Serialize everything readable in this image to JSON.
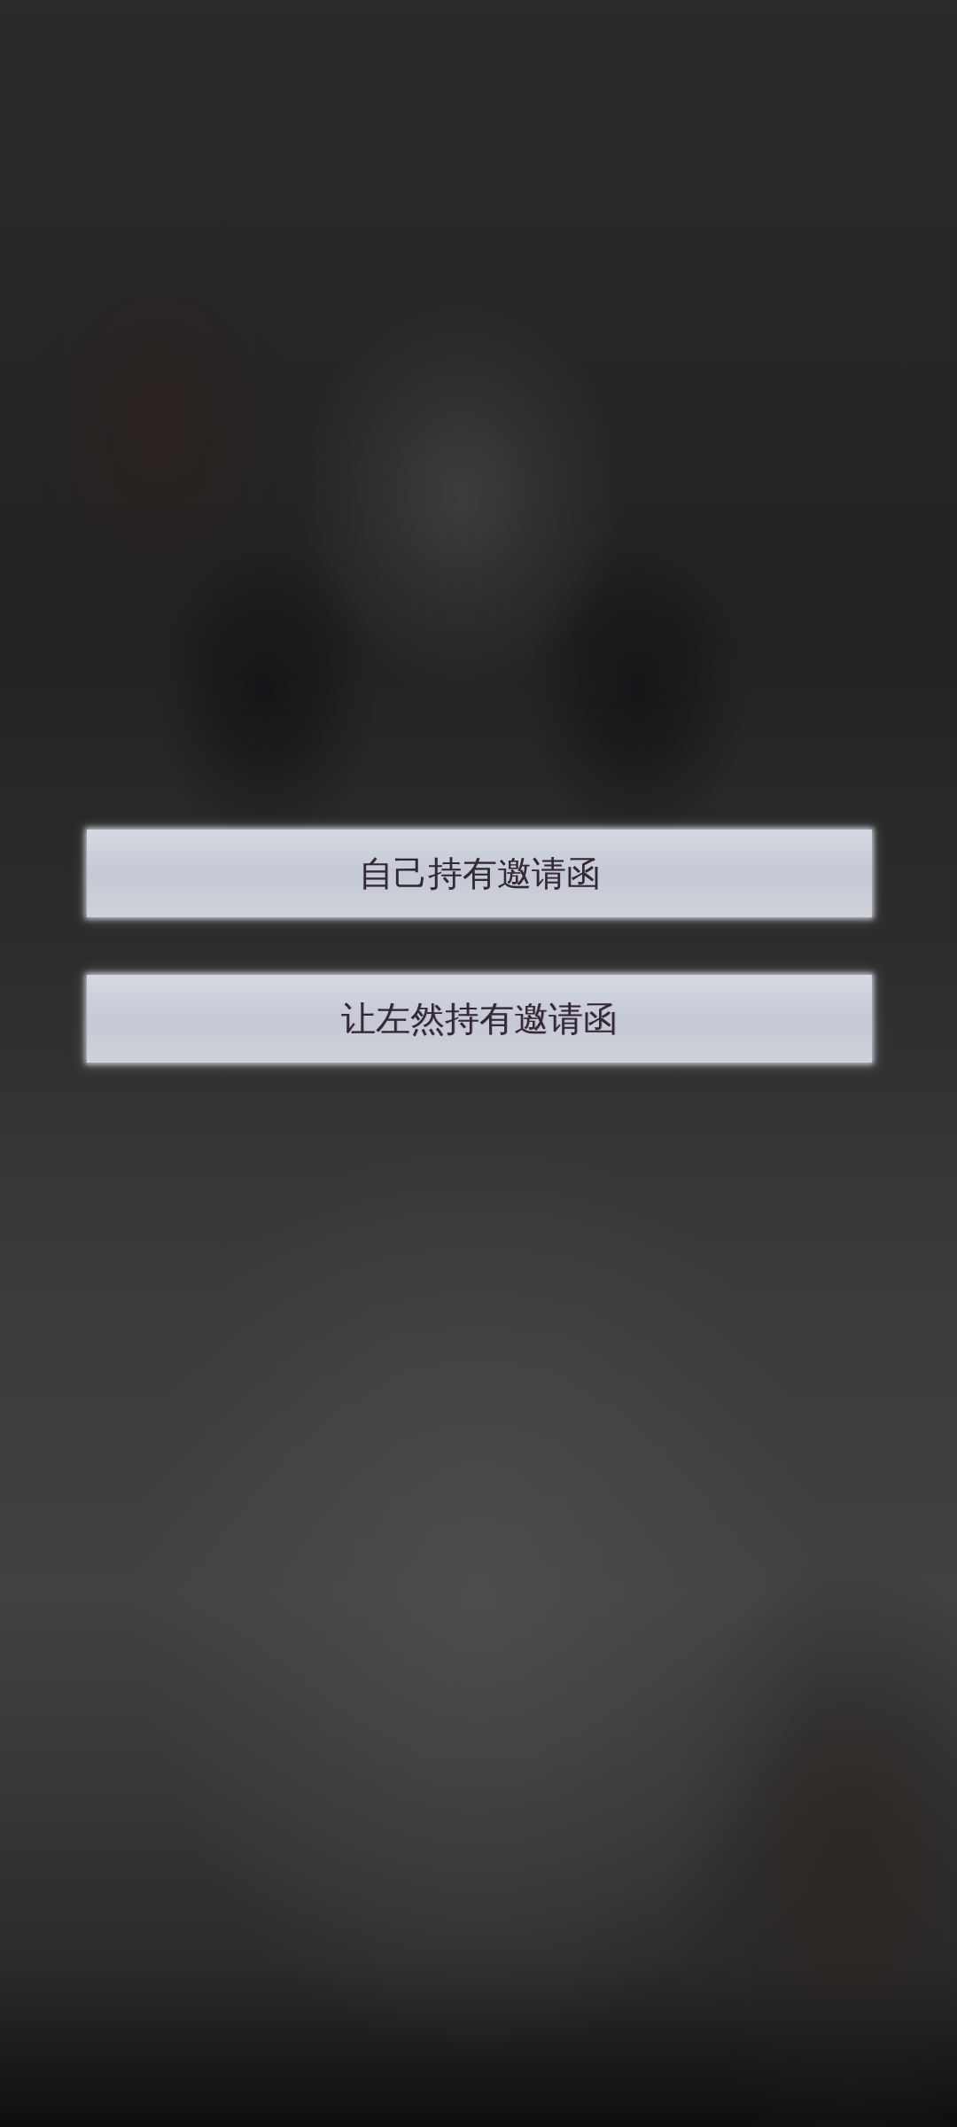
{
  "choices": [
    {
      "label": "自己持有邀请函"
    },
    {
      "label": "让左然持有邀请函"
    }
  ]
}
